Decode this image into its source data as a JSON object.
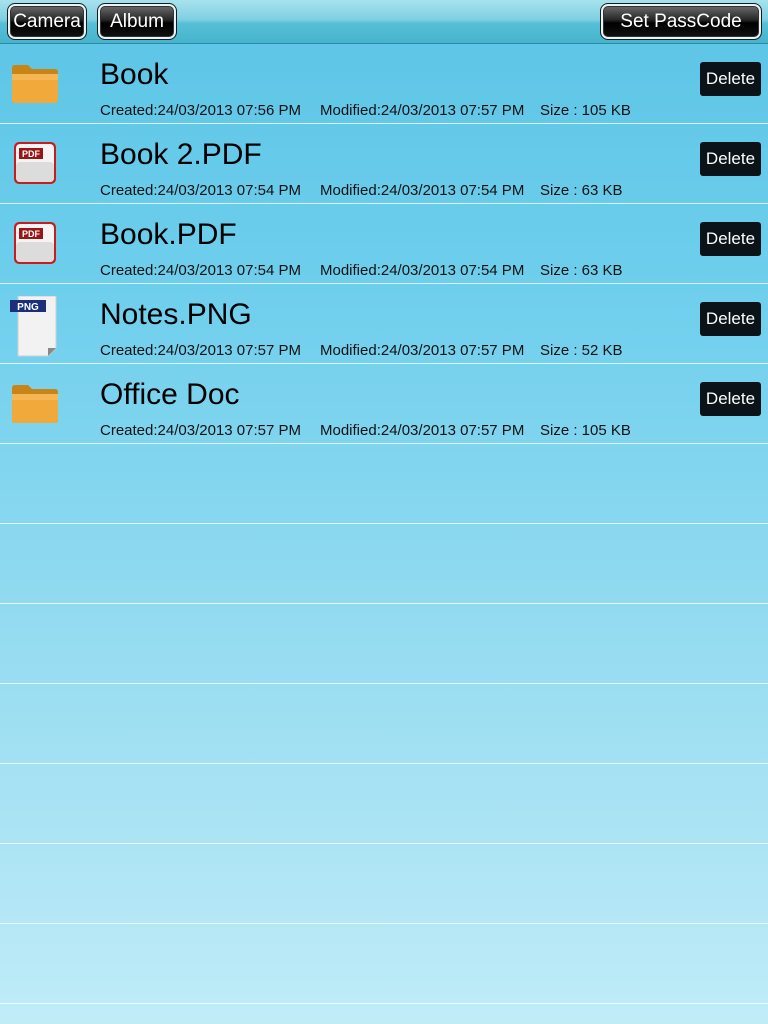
{
  "toolbar": {
    "camera_label": "Camera",
    "album_label": "Album",
    "passcode_label": "Set PassCode"
  },
  "files": [
    {
      "name": "Book",
      "icon": "folder-icon",
      "created": "Created:24/03/2013 07:56 PM",
      "modified": "Modified:24/03/2013 07:57 PM",
      "size": "Size : 105 KB",
      "delete_label": "Delete"
    },
    {
      "name": "Book 2.PDF",
      "icon": "pdf-file-icon",
      "created": "Created:24/03/2013 07:54 PM",
      "modified": "Modified:24/03/2013 07:54 PM",
      "size": "Size : 63 KB",
      "delete_label": "Delete"
    },
    {
      "name": "Book.PDF",
      "icon": "pdf-file-icon",
      "created": "Created:24/03/2013 07:54 PM",
      "modified": "Modified:24/03/2013 07:54 PM",
      "size": "Size : 63 KB",
      "delete_label": "Delete"
    },
    {
      "name": "Notes.PNG",
      "icon": "png-file-icon",
      "created": "Created:24/03/2013 07:57 PM",
      "modified": "Modified:24/03/2013 07:57 PM",
      "size": "Size : 52 KB",
      "delete_label": "Delete"
    },
    {
      "name": "Office Doc",
      "icon": "folder-icon",
      "created": "Created:24/03/2013 07:57 PM",
      "modified": "Modified:24/03/2013 07:57 PM",
      "size": "Size : 105 KB",
      "delete_label": "Delete"
    }
  ],
  "icon_labels": {
    "pdf": "PDF",
    "png": "PNG"
  },
  "colors": {
    "background_top": "#5cc4e6",
    "background_bottom": "#c0ecf8",
    "button_dark": "#0b1218"
  }
}
